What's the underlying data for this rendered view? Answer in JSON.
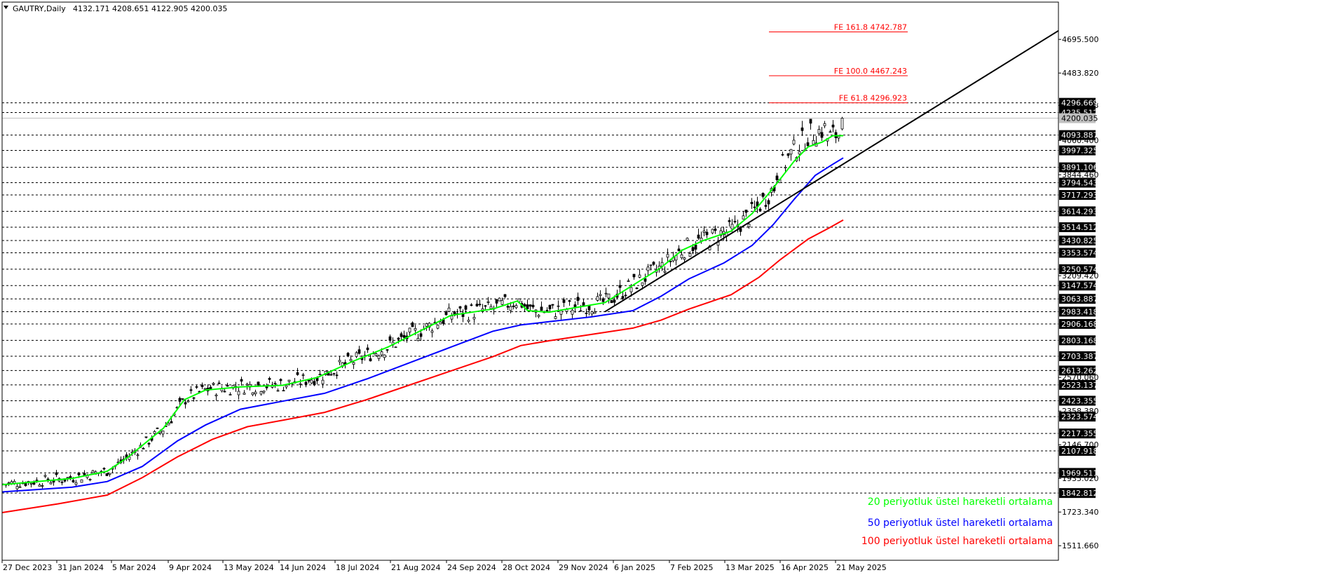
{
  "chart_data": {
    "type": "candlestick",
    "symbol": "GAUTRY",
    "timeframe": "Daily",
    "header_title": "GAUTRY,Daily",
    "header_ohlc": "4132.171 4208.651 4122.905 4200.035",
    "ohlc_last": {
      "open": 4132.171,
      "high": 4208.651,
      "low": 4122.905,
      "close": 4200.035
    },
    "ylim": [
      1420,
      4930
    ],
    "grid": false,
    "y_ticks": [
      "4695.500",
      "4483.820",
      "4280.833",
      "4060.400",
      "3844.460",
      "3209.420",
      "2570.060",
      "2358.380",
      "2146.700",
      "1935.020",
      "1723.340",
      "1511.660"
    ],
    "x_ticks": [
      "27 Dec 2023",
      "31 Jan 2024",
      "5 Mar 2024",
      "9 Apr 2024",
      "13 May 2024",
      "14 Jun 2024",
      "18 Jul 2024",
      "21 Aug 2024",
      "24 Sep 2024",
      "28 Oct 2024",
      "29 Nov 2024",
      "6 Jan 2025",
      "7 Feb 2025",
      "13 Mar 2025",
      "16 Apr 2025",
      "21 May 2025"
    ],
    "levels": [
      {
        "value": 4296.669,
        "label": "4296.669"
      },
      {
        "value": 4235.512,
        "label": "4235.512"
      },
      {
        "value": 4093.887,
        "label": "4093.887"
      },
      {
        "value": 3997.325,
        "label": "3997.325"
      },
      {
        "value": 3891.106,
        "label": "3891.106"
      },
      {
        "value": 3794.543,
        "label": "3794.543"
      },
      {
        "value": 3717.293,
        "label": "3717.293"
      },
      {
        "value": 3614.293,
        "label": "3614.293"
      },
      {
        "value": 3514.512,
        "label": "3514.512"
      },
      {
        "value": 3430.825,
        "label": "3430.825"
      },
      {
        "value": 3353.574,
        "label": "3353.574"
      },
      {
        "value": 3250.574,
        "label": "3250.574"
      },
      {
        "value": 3147.574,
        "label": "3147.574"
      },
      {
        "value": 3063.887,
        "label": "3063.887"
      },
      {
        "value": 2983.418,
        "label": "2983.418"
      },
      {
        "value": 2906.168,
        "label": "2906.168"
      },
      {
        "value": 2803.168,
        "label": "2803.168"
      },
      {
        "value": 2703.387,
        "label": "2703.387"
      },
      {
        "value": 2613.262,
        "label": "2613.262"
      },
      {
        "value": 2523.137,
        "label": "2523.137"
      },
      {
        "value": 2423.355,
        "label": "2423.355"
      },
      {
        "value": 2323.574,
        "label": "2323.574"
      },
      {
        "value": 2217.355,
        "label": "2217.355"
      },
      {
        "value": 2107.918,
        "label": "2107.918"
      },
      {
        "value": 1969.511,
        "label": "1969.511"
      },
      {
        "value": 1842.812,
        "label": "1842.812"
      }
    ],
    "current_price": {
      "value": 4200.035,
      "label": "4200.035"
    },
    "fibonacci": [
      {
        "value": 4742.787,
        "label": "FE 161.8 4742.787"
      },
      {
        "value": 4467.243,
        "label": "FE 100.0 4467.243"
      },
      {
        "value": 4296.923,
        "label": "FE 61.8 4296.923"
      }
    ],
    "trendline": {
      "x_start": "14 Mar 2025",
      "y_start": 3430,
      "x_end": "right edge",
      "y_end": 4750
    },
    "series": [
      {
        "name": "20 periyotluk üstel hareketli ortalama",
        "color": "#00ff00",
        "points": [
          [
            0,
            1895
          ],
          [
            100,
            1935
          ],
          [
            150,
            1980
          ],
          [
            180,
            2070
          ],
          [
            230,
            2250
          ],
          [
            260,
            2430
          ],
          [
            290,
            2490
          ],
          [
            340,
            2510
          ],
          [
            400,
            2520
          ],
          [
            450,
            2570
          ],
          [
            500,
            2670
          ],
          [
            550,
            2760
          ],
          [
            600,
            2870
          ],
          [
            640,
            2960
          ],
          [
            700,
            3000
          ],
          [
            735,
            3050
          ],
          [
            750,
            2990
          ],
          [
            780,
            2980
          ],
          [
            820,
            3010
          ],
          [
            860,
            3040
          ],
          [
            900,
            3150
          ],
          [
            940,
            3260
          ],
          [
            970,
            3370
          ],
          [
            1000,
            3430
          ],
          [
            1040,
            3490
          ],
          [
            1070,
            3600
          ],
          [
            1100,
            3760
          ],
          [
            1130,
            3930
          ],
          [
            1150,
            4020
          ],
          [
            1170,
            4050
          ],
          [
            1185,
            4090
          ],
          [
            1200,
            4090
          ]
        ]
      },
      {
        "name": "50 periyotluk üstel hareketli ortalama",
        "color": "#0000ff",
        "points": [
          [
            0,
            1850
          ],
          [
            100,
            1880
          ],
          [
            150,
            1915
          ],
          [
            200,
            2010
          ],
          [
            250,
            2170
          ],
          [
            290,
            2270
          ],
          [
            340,
            2370
          ],
          [
            400,
            2420
          ],
          [
            460,
            2470
          ],
          [
            520,
            2560
          ],
          [
            580,
            2660
          ],
          [
            640,
            2760
          ],
          [
            700,
            2860
          ],
          [
            740,
            2900
          ],
          [
            780,
            2920
          ],
          [
            840,
            2950
          ],
          [
            900,
            2990
          ],
          [
            940,
            3080
          ],
          [
            980,
            3190
          ],
          [
            1030,
            3290
          ],
          [
            1070,
            3400
          ],
          [
            1100,
            3530
          ],
          [
            1130,
            3690
          ],
          [
            1160,
            3840
          ],
          [
            1185,
            3910
          ],
          [
            1200,
            3950
          ]
        ]
      },
      {
        "name": "100 periyotluk üstel hareketli ortalama",
        "color": "#ff0000",
        "points": [
          [
            0,
            1720
          ],
          [
            80,
            1775
          ],
          [
            150,
            1830
          ],
          [
            200,
            1940
          ],
          [
            250,
            2070
          ],
          [
            300,
            2180
          ],
          [
            350,
            2260
          ],
          [
            400,
            2300
          ],
          [
            460,
            2350
          ],
          [
            520,
            2430
          ],
          [
            580,
            2520
          ],
          [
            640,
            2610
          ],
          [
            700,
            2700
          ],
          [
            740,
            2770
          ],
          [
            780,
            2800
          ],
          [
            840,
            2840
          ],
          [
            900,
            2880
          ],
          [
            940,
            2930
          ],
          [
            980,
            3000
          ],
          [
            1040,
            3090
          ],
          [
            1080,
            3200
          ],
          [
            1110,
            3310
          ],
          [
            1150,
            3440
          ],
          [
            1180,
            3510
          ],
          [
            1200,
            3560
          ]
        ]
      }
    ],
    "legend_placement": "bottom-right"
  }
}
